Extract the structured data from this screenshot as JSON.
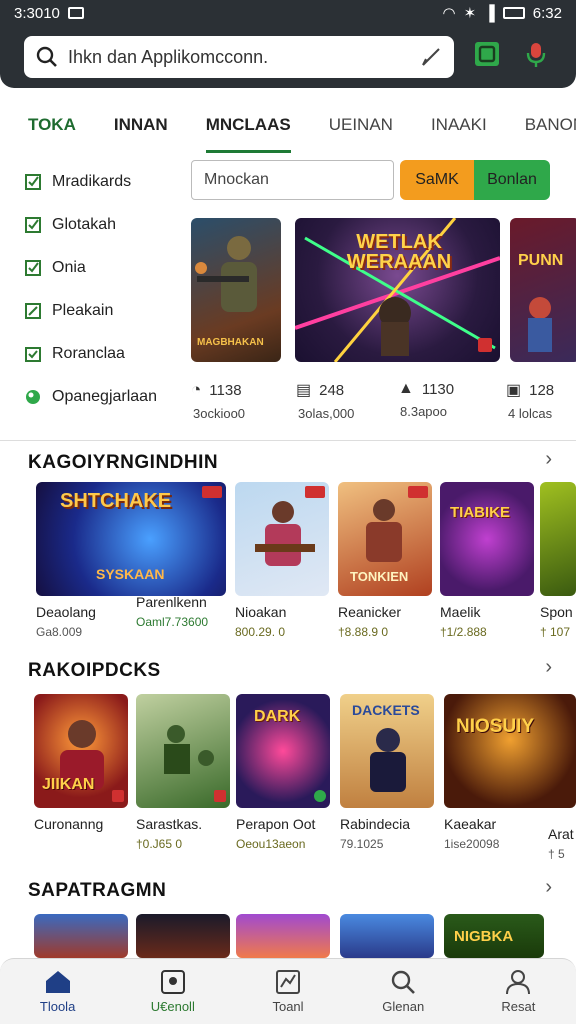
{
  "status_bar": {
    "left": "3:3010",
    "time": "6:32"
  },
  "search": {
    "text": "Ihkn dan Applikomcconn."
  },
  "tabs": [
    {
      "label": "TOKA"
    },
    {
      "label": "INNAN"
    },
    {
      "label": "MNCLAAS"
    },
    {
      "label": "UEINAN"
    },
    {
      "label": "INAAKI"
    },
    {
      "label": "BANON"
    }
  ],
  "sidebar": {
    "items": [
      {
        "label": "Mradikards"
      },
      {
        "label": "Glotakah"
      },
      {
        "label": "Onia"
      },
      {
        "label": "Pleakain"
      },
      {
        "label": "Roranclaa"
      },
      {
        "label": "Opanegjarlaan"
      }
    ]
  },
  "filter": {
    "value": "Mnockan",
    "btn_orange": "SaMK",
    "btn_green": "Bonlan"
  },
  "featured": {
    "main_title": "WETLAK WERAAAN",
    "left_caption": "MAGBHAKAN",
    "right_title": "PUNN"
  },
  "stats": [
    {
      "value": "1138",
      "sub": "3ockioo0"
    },
    {
      "value": "248",
      "sub": "3olas,000"
    },
    {
      "value": "1130",
      "sub": "8.3apoo"
    },
    {
      "value": "128",
      "sub": "4 lolcas"
    }
  ],
  "sections": [
    {
      "title": "KAGOIYRNGINDHIN",
      "items": [
        {
          "name": "Deaolang",
          "price": "Ga8.009",
          "title": "SHTCHAKE",
          "caption": "SYSKAAN"
        },
        {
          "name": "Parenlkenn",
          "price": "Oaml7.73600",
          "title": "",
          "caption": ""
        },
        {
          "name": "Nioakan",
          "price": "800.29. 0",
          "title": "",
          "caption": ""
        },
        {
          "name": "Reanicker",
          "price": "†8.88.9 0",
          "title": "",
          "caption": "TONKIEN"
        },
        {
          "name": "Maelik",
          "price": "†1/2.888",
          "title": "TIABIKE",
          "caption": ""
        },
        {
          "name": "Spon",
          "price": "† 107",
          "title": "",
          "caption": ""
        }
      ]
    },
    {
      "title": "RAKOIPDCKS",
      "items": [
        {
          "name": "Curonanng",
          "price": "",
          "title": "",
          "caption": "JIIKAN"
        },
        {
          "name": "Sarastkas.",
          "price": "†0.J65 0",
          "title": "",
          "caption": ""
        },
        {
          "name": "Perapon Oot",
          "price": "Oeou13aeon",
          "title": "DARK",
          "caption": ""
        },
        {
          "name": "Rabindecia",
          "price": "79.1025",
          "title": "DACKETS",
          "caption": ""
        },
        {
          "name": "Kaeakar",
          "price": "1ise20098",
          "title": "NIOSUIY",
          "caption": ""
        },
        {
          "name": "Arat",
          "price": "† 5",
          "title": "",
          "caption": ""
        }
      ]
    },
    {
      "title": "SAPATRAGMN",
      "items": [
        {
          "name": "",
          "price": "",
          "title": "",
          "caption": ""
        },
        {
          "name": "",
          "price": "",
          "title": "",
          "caption": ""
        },
        {
          "name": "",
          "price": "",
          "title": "",
          "caption": ""
        },
        {
          "name": "",
          "price": "",
          "title": "",
          "caption": ""
        },
        {
          "name": "",
          "price": "",
          "title": "NIGBKA",
          "caption": ""
        }
      ]
    }
  ],
  "bottom_nav": [
    {
      "label": "Tloola",
      "icon": "home-icon"
    },
    {
      "label": "U€enoll",
      "icon": "apps-icon"
    },
    {
      "label": "Toanl",
      "icon": "chart-icon"
    },
    {
      "label": "Glenan",
      "icon": "search-icon"
    },
    {
      "label": "Resat",
      "icon": "account-icon"
    }
  ],
  "colors": {
    "accent_green": "#2fa84a",
    "accent_orange": "#f39c1e",
    "header": "#2b3035",
    "tab_underline": "#1e7a35"
  }
}
